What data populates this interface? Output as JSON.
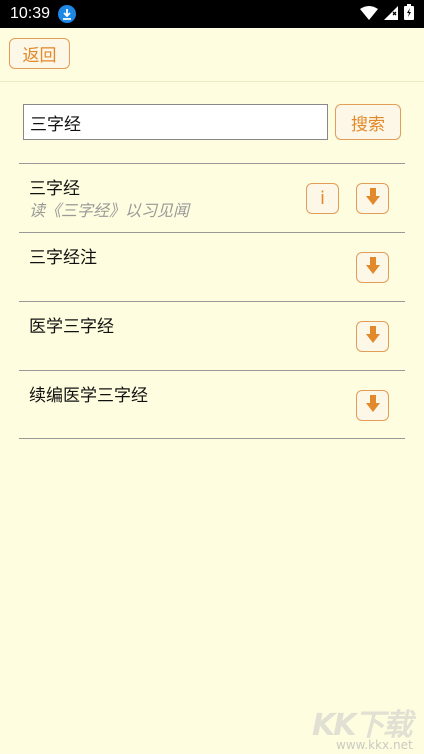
{
  "status_bar": {
    "time": "10:39"
  },
  "topbar": {
    "back_label": "返回"
  },
  "search": {
    "value": "三字经",
    "button_label": "搜索"
  },
  "results": [
    {
      "title": "三字经",
      "description": "读《三字经》以习见闻",
      "has_info": true
    },
    {
      "title": "三字经注",
      "description": "",
      "has_info": false
    },
    {
      "title": "医学三字经",
      "description": "",
      "has_info": false
    },
    {
      "title": "续编医学三字经",
      "description": "",
      "has_info": false
    }
  ],
  "info_label": "i",
  "watermark": {
    "text": "KK下载",
    "url": "www.kkx.net"
  },
  "colors": {
    "background": "#fefddf",
    "accent": "#e2892b",
    "divider": "#999999"
  }
}
